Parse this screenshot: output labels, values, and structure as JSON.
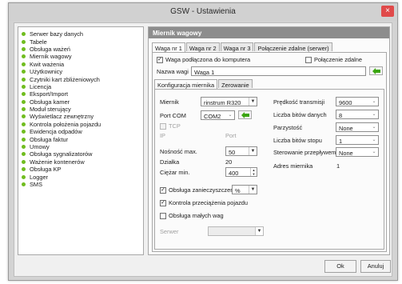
{
  "window": {
    "title": "GSW - Ustawienia",
    "close_glyph": "×"
  },
  "sidebar": {
    "items": [
      {
        "label": "Serwer bazy danych"
      },
      {
        "label": "Tabele"
      },
      {
        "label": "Obsługa ważeń"
      },
      {
        "label": "Miernik wagowy"
      },
      {
        "label": "Kwit ważenia"
      },
      {
        "label": "Użytkownicy"
      },
      {
        "label": "Czytniki kart zbliżeniowych"
      },
      {
        "label": "Licencja"
      },
      {
        "label": "Eksport/Import"
      },
      {
        "label": "Obsługa kamer"
      },
      {
        "label": "Moduł sterujący"
      },
      {
        "label": "Wyświetlacz zewnętrzny"
      },
      {
        "label": "Kontrola położenia pojazdu"
      },
      {
        "label": "Ewidencja odpadów"
      },
      {
        "label": "Obsługa faktur"
      },
      {
        "label": "Umowy"
      },
      {
        "label": "Obsługa sygnalizatorów"
      },
      {
        "label": "Ważenie kontenerów"
      },
      {
        "label": "Obsługa KP"
      },
      {
        "label": "Logger"
      },
      {
        "label": "SMS"
      }
    ],
    "bullet_color": "#70bd1f"
  },
  "panel": {
    "title": "Miernik wagowy",
    "tabs": [
      "Waga nr 1",
      "Waga nr 2",
      "Waga nr 3",
      "Połączenie zdalne (serwer)"
    ],
    "waga_connected_label": "Waga podłączona do komputera",
    "remote_label": "Połączenie zdalne",
    "scale_name_label": "Nazwa wagi",
    "scale_name_value": "Waga 1",
    "subtabs": [
      "Konfiguracja miernika",
      "Zerowanie"
    ],
    "config": {
      "miernik_label": "Miernik",
      "miernik_value": "rinstrum R320",
      "port_com_label": "Port COM",
      "port_com_value": "COM2",
      "tcp_label": "TCP",
      "ip_label": "IP",
      "port_label": "Port",
      "nosnosc_label": "Nośność max.",
      "nosnosc_value": "50",
      "dzialka_label": "Działka",
      "dzialka_value": "20",
      "ciezar_label": "Ciężar min.",
      "ciezar_value": "400",
      "zanieczyszczen_label": "Obsługa zanieczyszczeń",
      "zanieczyszczen_value": "%",
      "kontrola_label": "Kontrola przeciążenia pojazdu",
      "malych_wag_label": "Obsługa małych wag",
      "serwer_label": "Serwer",
      "serwer_value": "",
      "predkosc_label": "Prędkość transmisji",
      "predkosc_value": "9600",
      "bity_danych_label": "Liczba bitów danych",
      "bity_danych_value": "8",
      "parzystosc_label": "Parzystość",
      "parzystosc_value": "None",
      "bity_stopu_label": "Liczba bitów stopu",
      "bity_stopu_value": "1",
      "sterowanie_label": "Sterowanie przepływem",
      "sterowanie_value": "None",
      "adres_label": "Adres miernika",
      "adres_value": "1"
    },
    "checks": {
      "waga_connected": true,
      "remote": false,
      "tcp": false,
      "zanieczyszczen": true,
      "kontrola": true,
      "malych_wag": false
    }
  },
  "buttons": {
    "ok": "Ok",
    "cancel": "Anuluj"
  },
  "colors": {
    "arrow_green": "#3aa50f",
    "header_gray": "#8d8d8d",
    "close_red": "#e04a4a"
  },
  "icons": {
    "combo": "chevron-down-icon",
    "arrow": "arrow-left-icon",
    "close": "close-icon"
  }
}
